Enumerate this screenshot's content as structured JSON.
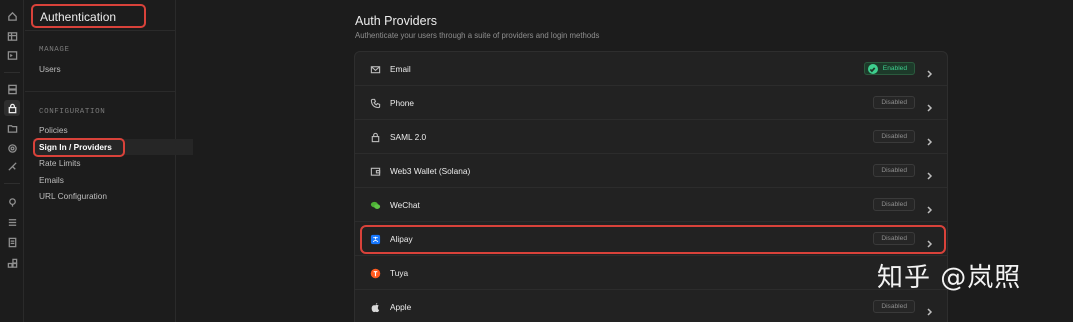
{
  "sidebar": {
    "title": "Authentication",
    "manage_section": "MANAGE",
    "manage_items": [
      {
        "label": "Users"
      }
    ],
    "config_section": "CONFIGURATION",
    "config_items": [
      {
        "label": "Policies"
      },
      {
        "label": "Sign In / Providers",
        "active": true
      },
      {
        "label": "Rate Limits"
      },
      {
        "label": "Emails"
      },
      {
        "label": "URL Configuration"
      }
    ]
  },
  "main": {
    "title": "Auth Providers",
    "subtitle": "Authenticate your users through a suite of providers and login methods",
    "providers": [
      {
        "name": "Email",
        "status": "Enabled",
        "icon": "mail-icon"
      },
      {
        "name": "Phone",
        "status": "Disabled",
        "icon": "phone-icon"
      },
      {
        "name": "SAML 2.0",
        "status": "Disabled",
        "icon": "lock-icon"
      },
      {
        "name": "Web3 Wallet (Solana)",
        "status": "Disabled",
        "icon": "wallet-icon"
      },
      {
        "name": "WeChat",
        "status": "Disabled",
        "icon": "wechat-icon"
      },
      {
        "name": "Alipay",
        "status": "Disabled",
        "icon": "alipay-icon"
      },
      {
        "name": "Tuya",
        "status": "",
        "icon": "tuya-icon"
      },
      {
        "name": "Apple",
        "status": "Disabled",
        "icon": "apple-icon"
      }
    ]
  },
  "watermark": "知乎 @岚照",
  "colors": {
    "background": "#1c1c1c",
    "accent_green": "#3ecf8e",
    "highlight_red": "#d9423a"
  }
}
